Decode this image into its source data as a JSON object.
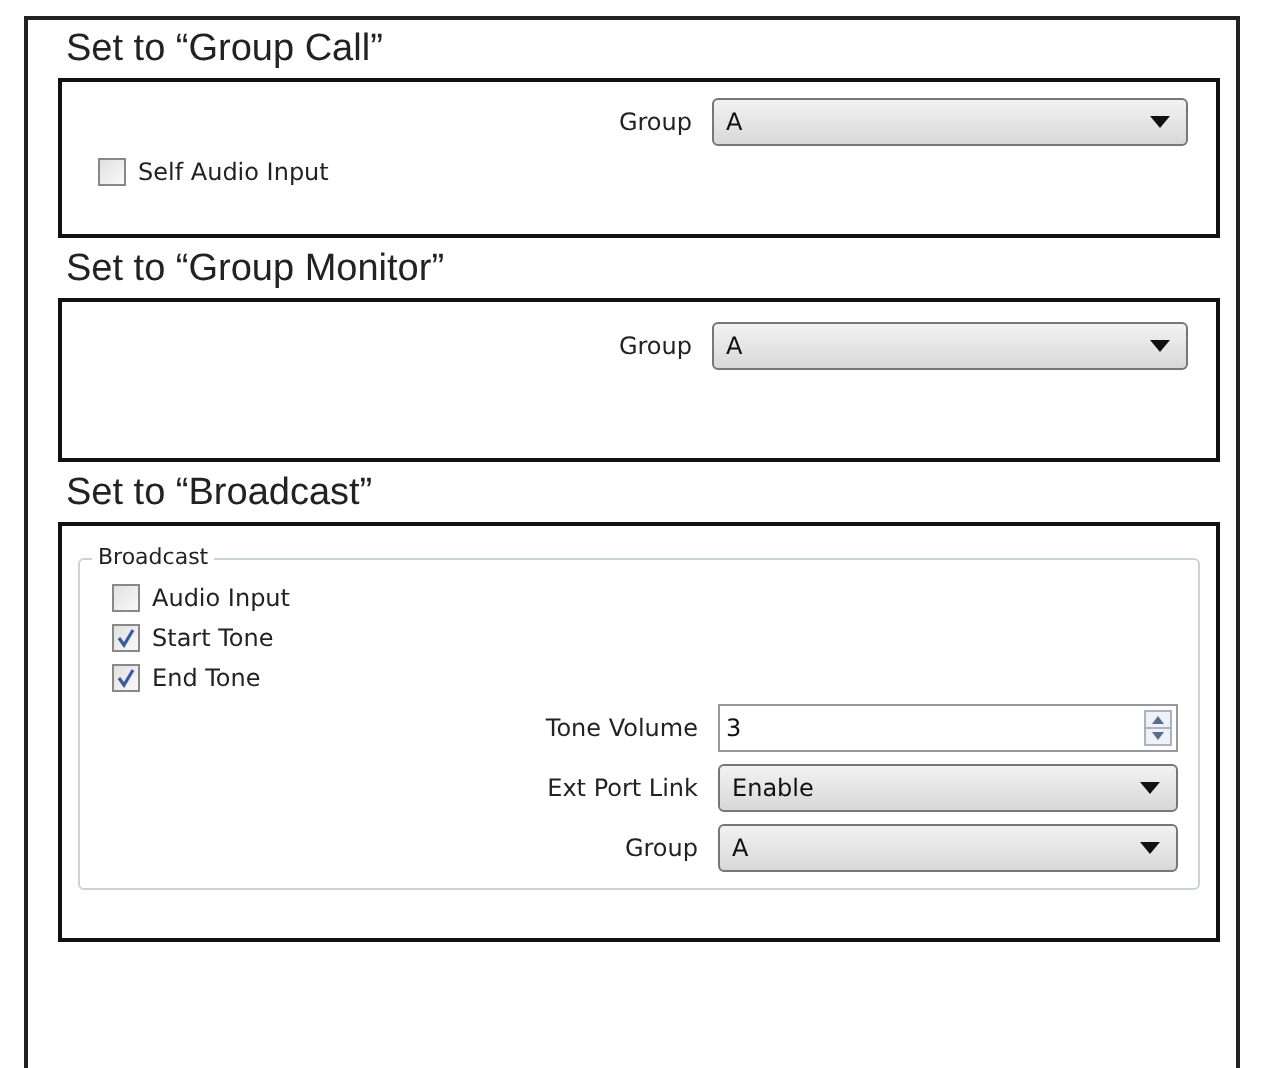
{
  "sections": [
    {
      "heading": "Set to “Group Call”",
      "panel": {
        "items": [
          {
            "kind": "combo",
            "label": "Group",
            "value": "A"
          },
          {
            "kind": "checkbox",
            "label": "Self Audio Input",
            "checked": false
          }
        ]
      }
    },
    {
      "heading": "Set to “Group Monitor”",
      "panel": {
        "items": [
          {
            "kind": "combo",
            "label": "Group",
            "value": "A"
          }
        ]
      }
    },
    {
      "heading": "Set to “Broadcast”",
      "panel": {
        "group_title": "Broadcast",
        "items": [
          {
            "kind": "checkbox",
            "label": "Audio Input",
            "checked": false
          },
          {
            "kind": "checkbox",
            "label": "Start Tone",
            "checked": true
          },
          {
            "kind": "checkbox",
            "label": "End Tone",
            "checked": true
          },
          {
            "kind": "spin",
            "label": "Tone Volume",
            "value": "3"
          },
          {
            "kind": "combo",
            "label": "Ext Port Link",
            "value": "Enable"
          },
          {
            "kind": "combo",
            "label": "Group",
            "value": "A"
          }
        ]
      }
    }
  ]
}
